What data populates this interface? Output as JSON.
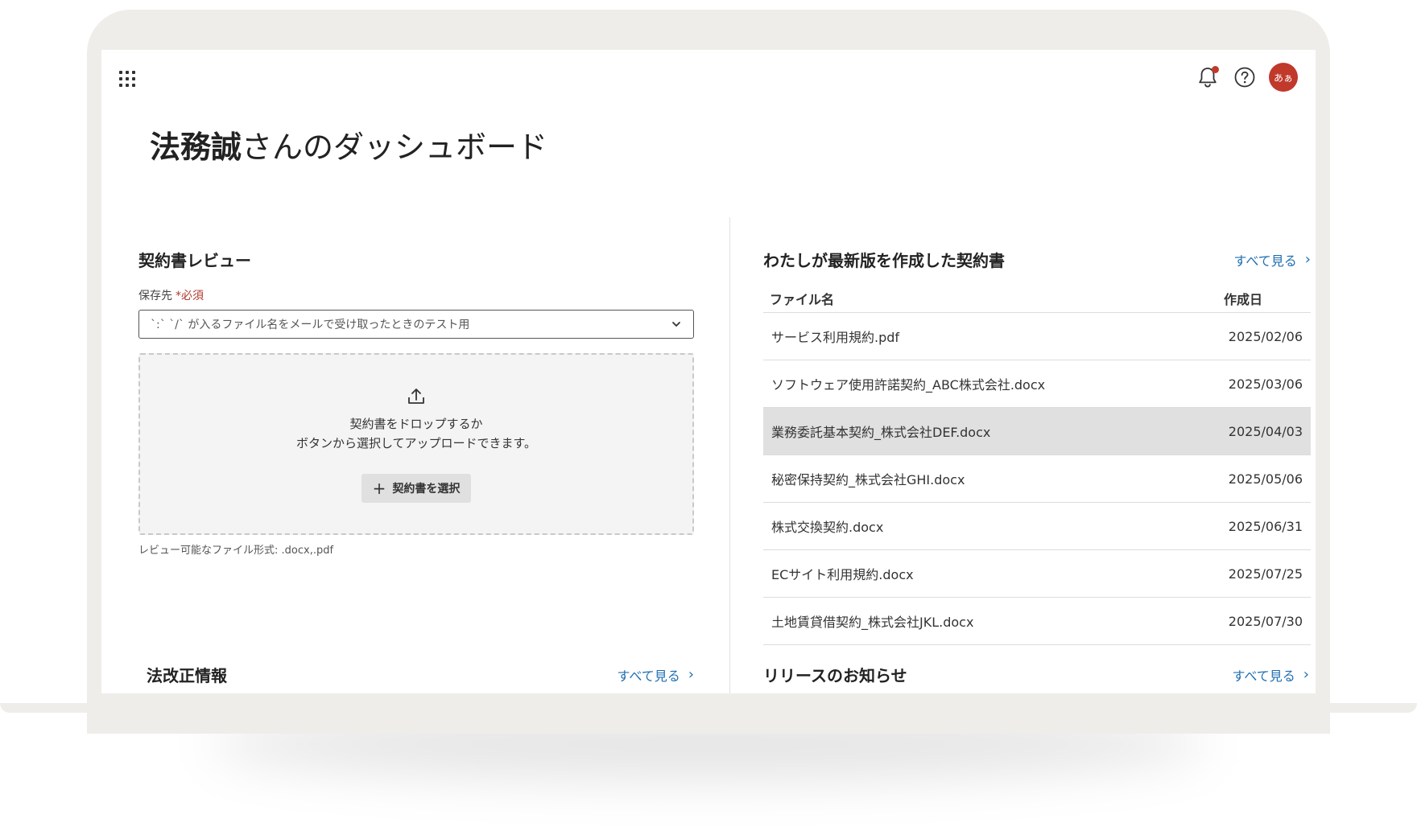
{
  "header": {
    "title_bold": "法務誠",
    "title_rest": "さんのダッシュボード",
    "avatar_text": "あぁ",
    "notification_dot_color": "#c0392b"
  },
  "review": {
    "title": "契約書レビュー",
    "save_label": "保存先",
    "required_label": "*必須",
    "select_value": "`:` `/` が入るファイル名をメールで受け取ったときのテスト用",
    "drop_line1": "契約書をドロップするか",
    "drop_line2": "ボタンから選択してアップロードできます。",
    "select_button": "契約書を選択",
    "formats_note": "レビュー可能なファイル形式: .docx,.pdf"
  },
  "mine": {
    "title": "わたしが最新版を作成した契約書",
    "see_all": "すべて見る",
    "col_name": "ファイル名",
    "col_date": "作成日",
    "rows": [
      {
        "name": "サービス利用規約.pdf",
        "date": "2025/02/06"
      },
      {
        "name": "ソフトウェア使用許諾契約_ABC株式会社.docx",
        "date": "2025/03/06"
      },
      {
        "name": "業務委託基本契約_株式会社DEF.docx",
        "date": "2025/04/03",
        "highlighted": true
      },
      {
        "name": "秘密保持契約_株式会社GHI.docx",
        "date": "2025/05/06"
      },
      {
        "name": "株式交換契約.docx",
        "date": "2025/06/31"
      },
      {
        "name": "ECサイト利用規約.docx",
        "date": "2025/07/25"
      },
      {
        "name": "土地賃貸借契約_株式会社JKL.docx",
        "date": "2025/07/30"
      }
    ]
  },
  "law": {
    "title": "法改正情報",
    "see_all": "すべて見る"
  },
  "release": {
    "title": "リリースのお知らせ",
    "see_all": "すべて見る"
  },
  "icons": [
    "apps-grid-icon",
    "bell-icon",
    "help-icon",
    "upload-icon",
    "chevron-down-icon",
    "chevron-right-icon",
    "plus-icon"
  ]
}
